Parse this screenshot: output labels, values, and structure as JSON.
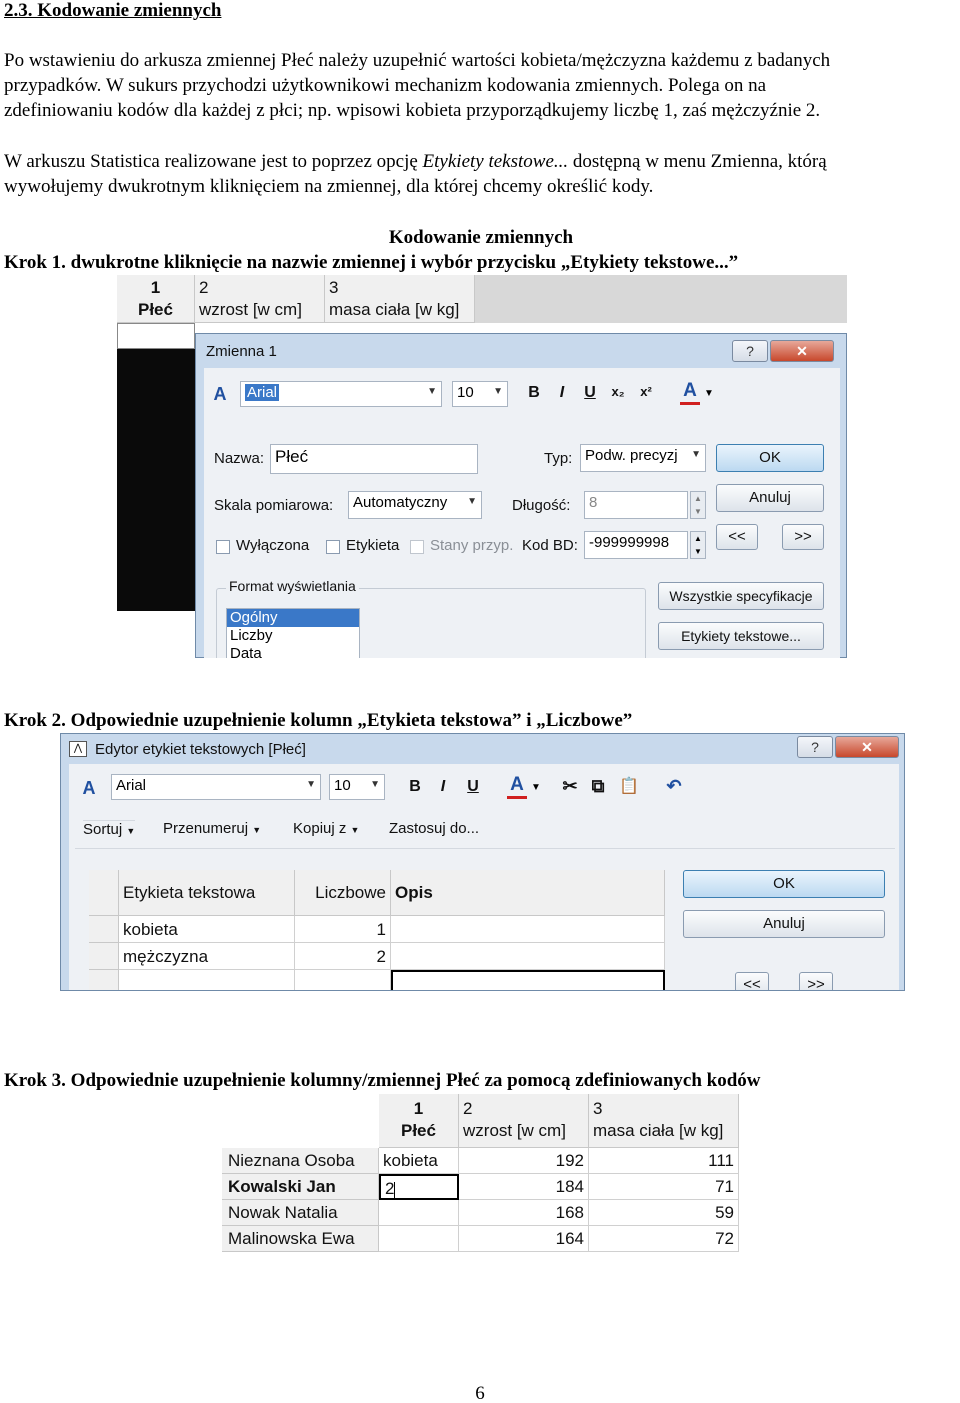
{
  "heading": "2.3. Kodowanie zmiennych",
  "para1": [
    "Po wstawieniu do arkusza zmiennej Płeć należy uzupełnić wartości kobieta/mężczyzna każdemu z badanych",
    "przypadków. W sukurs przychodzi użytkownikowi mechanizm kodowania zmiennych. Polega on na",
    "zdefiniowaniu kodów dla każdej z płci; np. wpisowi kobieta przyporządkujemy liczbę 1, zaś mężczyźnie 2."
  ],
  "para2": {
    "line1_a": "W arkuszu Statistica realizowane jest to poprzez opcję ",
    "line1_italic": "Etykiety tekstowe...",
    "line1_b": " dostępną w menu Zmienna, którą",
    "line2": "wywołujemy dwukrotnym kliknięciem na zmiennej, dla której chcemy określić kody."
  },
  "figure_title": "Kodowanie zmiennych",
  "step1": "Krok 1. dwukrotne kliknięcie na nazwie zmiennej i wybór przycisku „Etykiety tekstowe...”",
  "step2": "Krok 2. Odpowiednie uzupełnienie kolumn „Etykieta tekstowa” i „Liczbowe”",
  "step3": "Krok 3. Odpowiednie uzupełnienie kolumny/zmiennej Płeć za pomocą zdefiniowanych kodów",
  "page_number": "6",
  "shot1": {
    "col_headers": [
      {
        "num": "1",
        "name": "Płeć"
      },
      {
        "num": "2",
        "name": "wzrost [w cm]"
      },
      {
        "num": "3",
        "name": "masa ciała [w kg]"
      }
    ],
    "dialog_title": "Zmienna 1",
    "help": "?",
    "close": "✕",
    "font_name": "Arial",
    "font_size": "10",
    "fmt_bold": "B",
    "fmt_italic": "I",
    "fmt_underline": "U",
    "fmt_sub": "x₂",
    "fmt_sup": "x²",
    "fmt_color": "A",
    "font_icon": "A",
    "name_label": "Nazwa:",
    "name_value": "Płeć",
    "type_label": "Typ:",
    "type_value": "Podw. precyzj",
    "ok": "OK",
    "scale_label": "Skala pomiarowa:",
    "scale_value": "Automatyczny",
    "length_label": "Długość:",
    "length_value": "8",
    "cancel": "Anuluj",
    "excluded": "Wyłączona",
    "label_chk": "Etykieta",
    "states": "Stany przyp.",
    "md_label": "Kod BD:",
    "md_value": "-999999998",
    "prev": "<<",
    "next": ">>",
    "format_group": "Format wyświetlania",
    "format_items": [
      "Ogólny",
      "Liczby",
      "Data"
    ],
    "all_specs": "Wszystkie specyfikacje",
    "text_labels_btn": "Etykiety tekstowe..."
  },
  "shot2": {
    "title": "Edytor etykiet tekstowych [Płeć]",
    "help": "?",
    "close": "✕",
    "font_icon": "A",
    "font_name": "Arial",
    "font_size": "10",
    "fmt_bold": "B",
    "fmt_italic": "I",
    "fmt_underline": "U",
    "fmt_color": "A",
    "cut": "✂",
    "copy": "⧉",
    "paste": "📋",
    "undo": "↶",
    "menu": [
      "Sortuj",
      "Przenumeruj",
      "Kopiuj z",
      "Zastosuj do..."
    ],
    "headers": [
      "Etykieta tekstowa",
      "Liczbowe",
      "Opis"
    ],
    "rows": [
      {
        "label": "kobieta",
        "value": "1"
      },
      {
        "label": "mężczyzna",
        "value": "2"
      }
    ],
    "ok": "OK",
    "cancel": "Anuluj",
    "prev": "<<",
    "next": ">>"
  },
  "shot3": {
    "headers": [
      {
        "num": "1",
        "name": "Płeć"
      },
      {
        "num": "2",
        "name": "wzrost [w cm]"
      },
      {
        "num": "3",
        "name": "masa ciała [w kg]"
      }
    ],
    "rows": [
      {
        "name": "Nieznana Osoba",
        "sex": "kobieta",
        "height": "192",
        "mass": "111"
      },
      {
        "name": "Kowalski Jan",
        "sex": "2",
        "height": "184",
        "mass": "71"
      },
      {
        "name": "Nowak Natalia",
        "sex": "",
        "height": "168",
        "mass": "59"
      },
      {
        "name": "Malinowska Ewa",
        "sex": "",
        "height": "164",
        "mass": "72"
      }
    ]
  }
}
